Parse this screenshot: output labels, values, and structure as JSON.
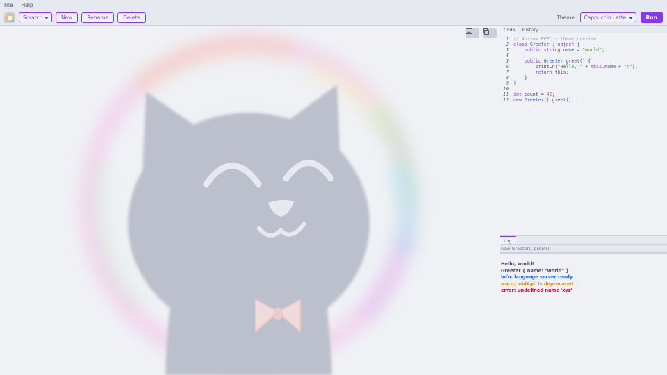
{
  "menu": {
    "file": "File",
    "help": "Help"
  },
  "toolbar": {
    "project_select": "Scratch",
    "new_label": "New",
    "rename_label": "Rename",
    "delete_label": "Delete",
    "theme_label": "Theme:",
    "theme_select": "Cappuccin Latte",
    "run_label": "Run"
  },
  "canvas": {
    "image_button_icon": "image-icon",
    "copy_button_icon": "copy-icon",
    "mascot": "cat-mascot-illustration"
  },
  "editor": {
    "tabs": [
      "Code",
      "History"
    ],
    "lines": [
      {
        "n": "1",
        "tokens": [
          {
            "t": "// Aussom REPL - theme preview",
            "c": "#9ca0b0",
            "i": true
          }
        ]
      },
      {
        "n": "2",
        "tokens": [
          {
            "t": "class ",
            "c": "#8839ef"
          },
          {
            "t": "Greeter",
            "c": "#1e66f5"
          },
          {
            "t": " : ",
            "c": "#4c4f69"
          },
          {
            "t": "object",
            "c": "#8839ef"
          },
          {
            "t": " {",
            "c": "#4c4f69"
          }
        ]
      },
      {
        "n": "3",
        "tokens": [
          {
            "t": "    public ",
            "c": "#8839ef"
          },
          {
            "t": "string",
            "c": "#8839ef"
          },
          {
            "t": " name = ",
            "c": "#4c4f69"
          },
          {
            "t": "\"world\"",
            "c": "#40a02b"
          },
          {
            "t": ";",
            "c": "#4c4f69"
          }
        ]
      },
      {
        "n": "4",
        "tokens": []
      },
      {
        "n": "5",
        "tokens": [
          {
            "t": "    public ",
            "c": "#8839ef"
          },
          {
            "t": "Greeter",
            "c": "#1e66f5"
          },
          {
            "t": " greet() {",
            "c": "#4c4f69"
          }
        ]
      },
      {
        "n": "6",
        "tokens": [
          {
            "t": "        printLn(",
            "c": "#4c4f69"
          },
          {
            "t": "\"Hello, \"",
            "c": "#40a02b"
          },
          {
            "t": " + ",
            "c": "#4c4f69"
          },
          {
            "t": "this",
            "c": "#8839ef"
          },
          {
            "t": ".name + ",
            "c": "#4c4f69"
          },
          {
            "t": "\"!\"",
            "c": "#40a02b"
          },
          {
            "t": ");",
            "c": "#4c4f69"
          }
        ]
      },
      {
        "n": "7",
        "tokens": [
          {
            "t": "        return ",
            "c": "#8839ef"
          },
          {
            "t": "this",
            "c": "#8839ef"
          },
          {
            "t": ";",
            "c": "#4c4f69"
          }
        ]
      },
      {
        "n": "8",
        "tokens": [
          {
            "t": "    }",
            "c": "#4c4f69"
          }
        ]
      },
      {
        "n": "9",
        "tokens": [
          {
            "t": "}",
            "c": "#4c4f69"
          }
        ]
      },
      {
        "n": "10",
        "tokens": []
      },
      {
        "n": "11",
        "tokens": [
          {
            "t": "int",
            "c": "#8839ef"
          },
          {
            "t": " count = ",
            "c": "#4c4f69"
          },
          {
            "t": "42",
            "c": "#fe640b"
          },
          {
            "t": ";",
            "c": "#4c4f69"
          }
        ]
      },
      {
        "n": "12",
        "tokens": [
          {
            "t": "new ",
            "c": "#8839ef"
          },
          {
            "t": "Greeter",
            "c": "#1e66f5"
          },
          {
            "t": "().greet();",
            "c": "#4c4f69"
          }
        ]
      }
    ]
  },
  "log": {
    "tab": "Log",
    "input": "new Greeter().greet();",
    "lines": [
      {
        "text": "Hello, world!",
        "color": "#4c4f69"
      },
      {
        "text": "Greeter { name: \"world\" }",
        "color": "#4c4f69"
      },
      {
        "text": "info: language server ready",
        "color": "#1e66f5"
      },
      {
        "text": "warn: 'oldApi' is deprecated",
        "color": "#df8e1d"
      },
      {
        "text": "error: undefined name 'xyz'",
        "color": "#d20f39"
      }
    ]
  },
  "colors": {
    "accent": "#8839ef",
    "base": "#eff1f5",
    "mantle": "#e6e9ef",
    "text": "#4c4f69"
  }
}
